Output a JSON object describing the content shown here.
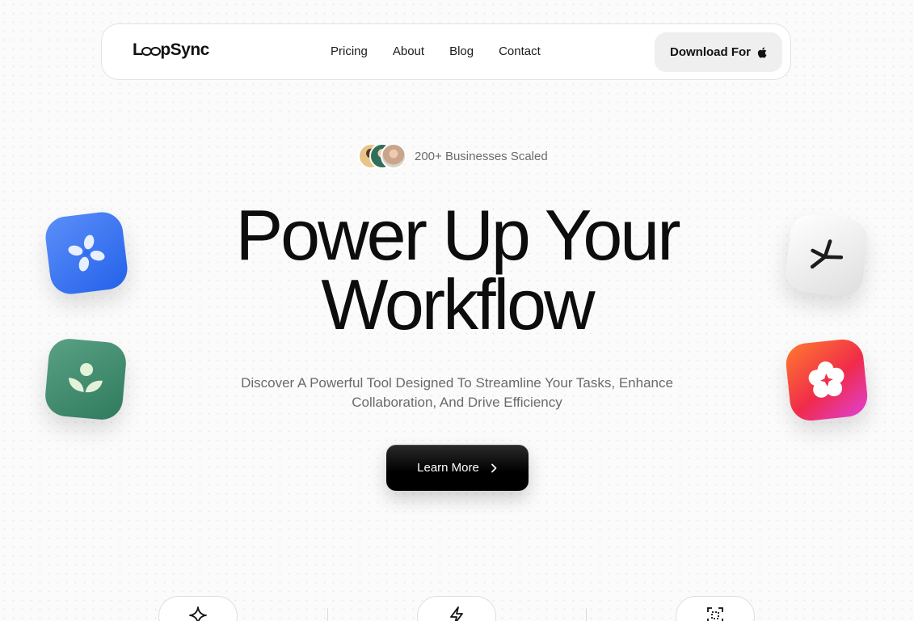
{
  "brand": {
    "name_prefix": "L",
    "name_suffix": "pSync"
  },
  "nav": {
    "links": [
      "Pricing",
      "About",
      "Blog",
      "Contact"
    ],
    "download_label": "Download For"
  },
  "social_proof": {
    "text": "200+ Businesses Scaled"
  },
  "hero": {
    "title_line1": "Power Up Your",
    "title_line2": "Workflow",
    "subtitle_line1": "Discover A Powerful Tool Designed To Streamline Your Tasks, Enhance",
    "subtitle_line2": "Collaboration, And Drive Efficiency",
    "cta_label": "Learn More"
  },
  "tiles": [
    {
      "name": "blue-pinwheel-app",
      "color": "#2f6ef0"
    },
    {
      "name": "green-sprout-app",
      "color": "#3d8a6c"
    },
    {
      "name": "white-asterisk-app",
      "color": "#f2f2f2"
    },
    {
      "name": "red-flower-app",
      "color": "#f33a3a"
    }
  ],
  "features": {
    "icons": [
      "sparkle-icon",
      "lightning-icon",
      "scan-frame-icon"
    ]
  },
  "colors": {
    "accent": "#111111",
    "text_muted": "#6b6b6b",
    "background": "#fbfbfb"
  }
}
